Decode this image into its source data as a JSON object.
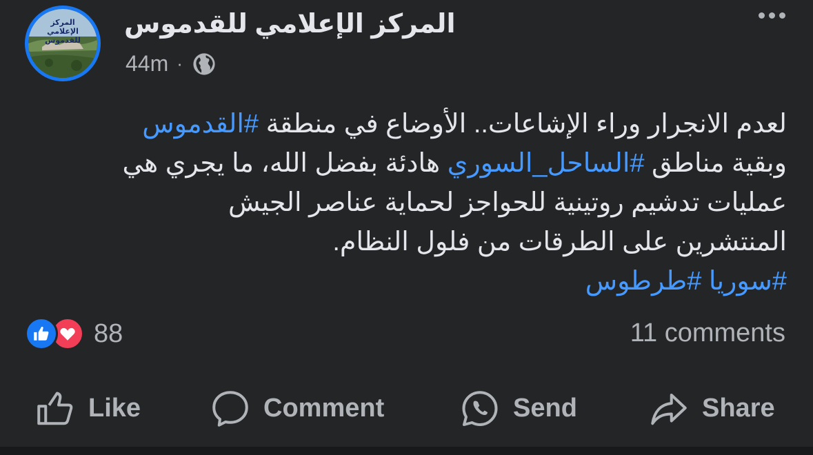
{
  "page": {
    "name": "المركز الإعلامي للقدموس",
    "avatar_text": "المركز الإعلامي للقدموس",
    "time": "44m",
    "separator": "·"
  },
  "post": {
    "line1_text": "لعدم الانجرار وراء الإشاعات.. الأوضاع في منطقة ",
    "line1_tag": "#القدموس",
    "line2_text_a": "وبقية مناطق ",
    "line2_tag": "#الساحل_السوري",
    "line2_text_b": " هادئة بفضل الله، ما يجري هي",
    "line3_text": "عمليات تدشيم  روتينية للحواجز لحماية عناصر الجيش",
    "line4_text": "المنتشرين على الطرقات من فلول النظام.",
    "tag_syria": "#سوريا",
    "tag_tartus": "#طرطوس"
  },
  "stats": {
    "reaction_count": "88",
    "comments": "11 comments"
  },
  "actions": {
    "like": "Like",
    "comment": "Comment",
    "send": "Send",
    "share": "Share"
  },
  "colors": {
    "background": "#242526",
    "hashtag": "#4599ff",
    "like_blue": "#1877f2",
    "love_red": "#f33e58",
    "secondary_text": "#b0b3b8"
  },
  "icons": {
    "more": "more-horizontal-icon",
    "audience": "globe-icon",
    "like_reaction": "thumbs-up-icon",
    "love_reaction": "heart-icon",
    "like_action": "thumbs-up-outline-icon",
    "comment_action": "speech-bubble-icon",
    "send_action": "messenger-whatsapp-icon",
    "share_action": "share-arrow-icon"
  }
}
